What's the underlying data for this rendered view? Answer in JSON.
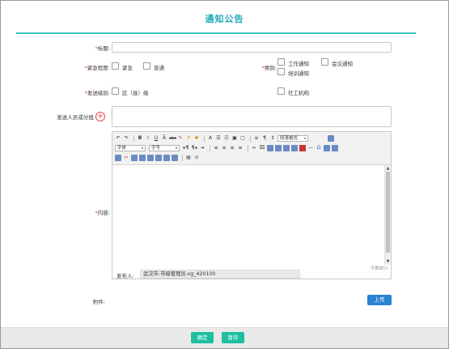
{
  "page": {
    "title": "通知公告"
  },
  "form": {
    "title_label": "标题:",
    "urgency_label": "紧急程度:",
    "urgency_options": [
      "紧急",
      "普通"
    ],
    "category_label": "类别:",
    "category_options": [
      "工作通知",
      "会议通知",
      "培训通知"
    ],
    "send_level_label": "发送级别:",
    "send_level_options": [
      "区（县）级",
      "社工机构"
    ],
    "recipients_label": "发送人员或分组:",
    "content_label": "内容:",
    "attachment_label": "附件:",
    "upload_button": "上传"
  },
  "editor": {
    "font_family": "字体",
    "font_size": "字号",
    "paragraph_format": "段落格式",
    "word_count": "字数统计",
    "publisher_label": "发布人:",
    "publisher_value": "武汉市-市级管理员-sg_420100"
  },
  "footer": {
    "confirm_button": "确定",
    "save_draft_button": "暂存"
  },
  "colors": {
    "accent": "#1aa9b9",
    "primary_blue": "#2a83d2",
    "button_green": "#1fbfa0",
    "required_red": "#e33333"
  }
}
